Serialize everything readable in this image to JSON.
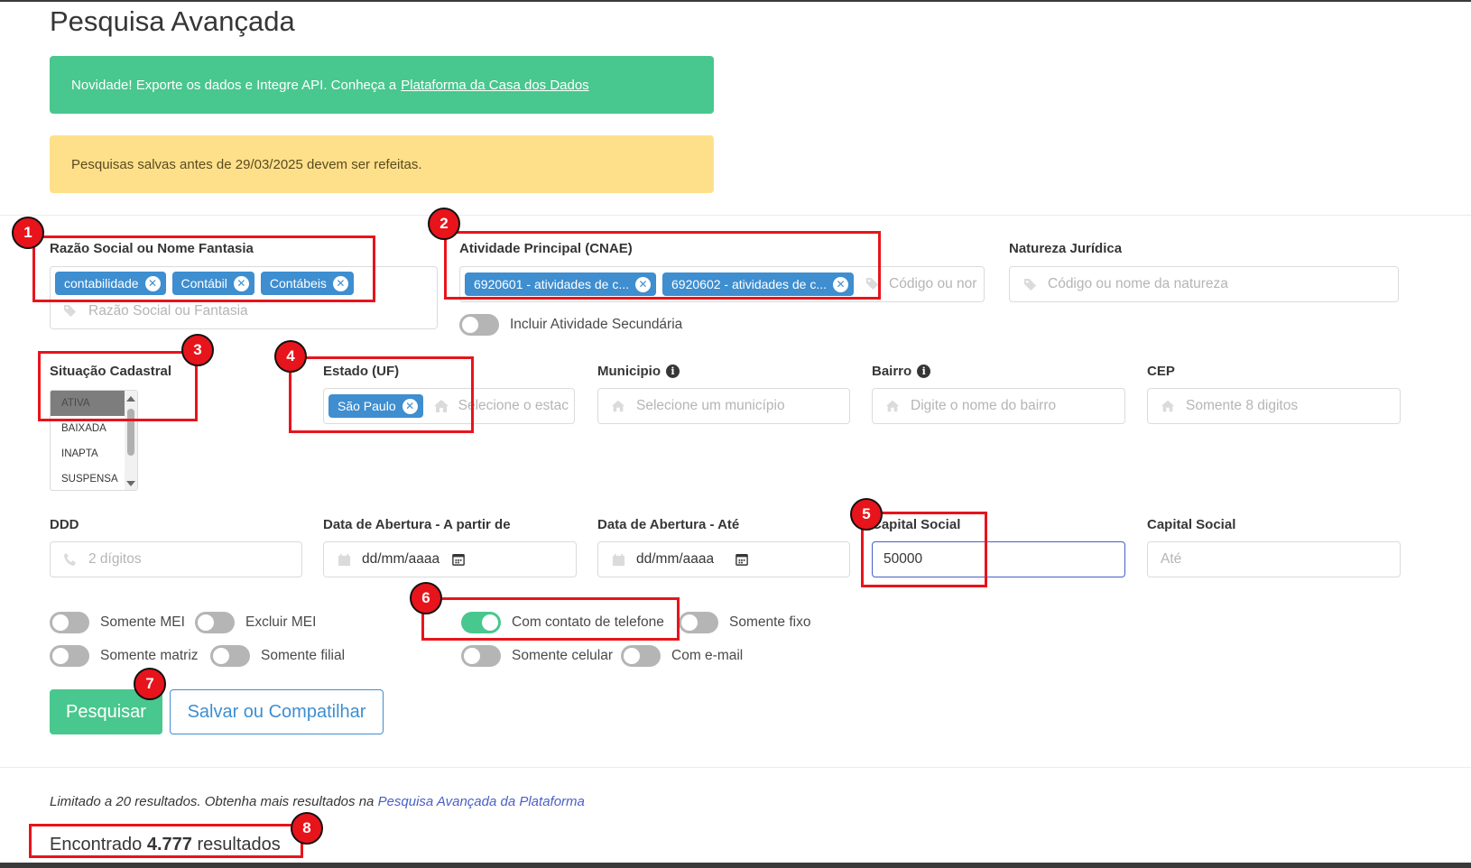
{
  "page": {
    "title": "Pesquisa Avançada"
  },
  "notices": {
    "export_text": "Novidade! Exporte os dados e Integre API. Conheça a",
    "export_link": "Plataforma da Casa dos Dados",
    "saved_warning": "Pesquisas salvas antes de 29/03/2025 devem ser refeitas."
  },
  "fields": {
    "razao": {
      "label": "Razão Social ou Nome Fantasia",
      "tags": [
        "contabilidade",
        "Contábil",
        "Contábeis"
      ],
      "placeholder": "Razão Social ou Fantasia"
    },
    "cnae": {
      "label": "Atividade Principal (CNAE)",
      "tags": [
        "6920601 - atividades de c...",
        "6920602 - atividades de c..."
      ],
      "placeholder": "Código ou nor"
    },
    "secundaria": {
      "label": "Incluir Atividade Secundária",
      "on": false
    },
    "natureza": {
      "label": "Natureza Jurídica",
      "placeholder": "Código ou nome da natureza"
    },
    "situacao": {
      "label": "Situação Cadastral",
      "options": [
        "ATIVA",
        "BAIXADA",
        "INAPTA",
        "SUSPENSA"
      ],
      "selected": "ATIVA"
    },
    "estado": {
      "label": "Estado (UF)",
      "tags": [
        "São Paulo"
      ],
      "placeholder": "Selecione o estac"
    },
    "municipio": {
      "label": "Municipio",
      "placeholder": "Selecione um município"
    },
    "bairro": {
      "label": "Bairro",
      "placeholder": "Digite o nome do bairro"
    },
    "cep": {
      "label": "CEP",
      "placeholder": "Somente 8 digitos"
    },
    "ddd": {
      "label": "DDD",
      "placeholder": "2 dígitos"
    },
    "abertura_de": {
      "label": "Data de Abertura - A partir de",
      "placeholder": "dd/mm/aaaa"
    },
    "abertura_ate": {
      "label": "Data de Abertura - Até",
      "placeholder": "dd/mm/aaaa"
    },
    "capital_min": {
      "label": "Capital Social",
      "value": "50000"
    },
    "capital_max": {
      "label": "Capital Social",
      "placeholder": "Até"
    }
  },
  "switches": {
    "somente_mei": {
      "label": "Somente MEI",
      "on": false
    },
    "excluir_mei": {
      "label": "Excluir MEI",
      "on": false
    },
    "com_telefone": {
      "label": "Com contato de telefone",
      "on": true
    },
    "somente_fixo": {
      "label": "Somente fixo",
      "on": false
    },
    "somente_matriz": {
      "label": "Somente matriz",
      "on": false
    },
    "somente_filial": {
      "label": "Somente filial",
      "on": false
    },
    "somente_celular": {
      "label": "Somente celular",
      "on": false
    },
    "com_email": {
      "label": "Com e-mail",
      "on": false
    }
  },
  "buttons": {
    "search": "Pesquisar",
    "save": "Salvar ou Compatilhar"
  },
  "results": {
    "limit_text": "Limitado a 20 resultados. Obtenha mais resultados na",
    "limit_link": "Pesquisa Avançada da Plataforma",
    "found_prefix": "Encontrado",
    "found_count": "4.777",
    "found_suffix": "resultados"
  },
  "annotations": [
    "1",
    "2",
    "3",
    "4",
    "5",
    "6",
    "7",
    "8"
  ],
  "colors": {
    "primary": "#48c78e",
    "info": "#3e8ed0",
    "warning": "#ffe08a",
    "annotation": "#e8141b",
    "link": "#485fc7"
  }
}
